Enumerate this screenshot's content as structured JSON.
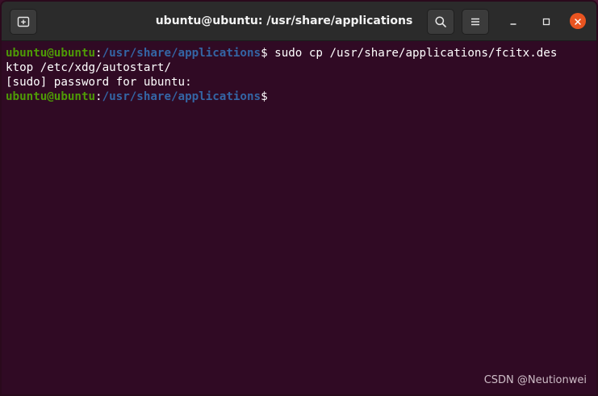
{
  "window": {
    "title": "ubuntu@ubuntu: /usr/share/applications"
  },
  "titlebar": {
    "new_tab_icon": "new-tab-icon",
    "search_icon": "search-icon",
    "menu_icon": "hamburger-menu-icon",
    "minimize_icon": "minimize-icon",
    "maximize_icon": "maximize-icon",
    "close_icon": "close-icon"
  },
  "terminal": {
    "lines": [
      {
        "user": "ubuntu@ubuntu",
        "sep": ":",
        "path": "/usr/share/applications",
        "prompt": "$",
        "cmd": " sudo cp /usr/share/applications/fcitx.des"
      },
      {
        "text": "ktop /etc/xdg/autostart/"
      },
      {
        "text": "[sudo] password for ubuntu:"
      },
      {
        "user": "ubuntu@ubuntu",
        "sep": ":",
        "path": "/usr/share/applications",
        "prompt": "$",
        "cmd": ""
      }
    ]
  },
  "watermark": "CSDN @Neutionwei",
  "colors": {
    "terminal_bg": "#300a24",
    "user_green": "#4e9a06",
    "path_blue": "#3465a4",
    "close_orange": "#e95420"
  }
}
